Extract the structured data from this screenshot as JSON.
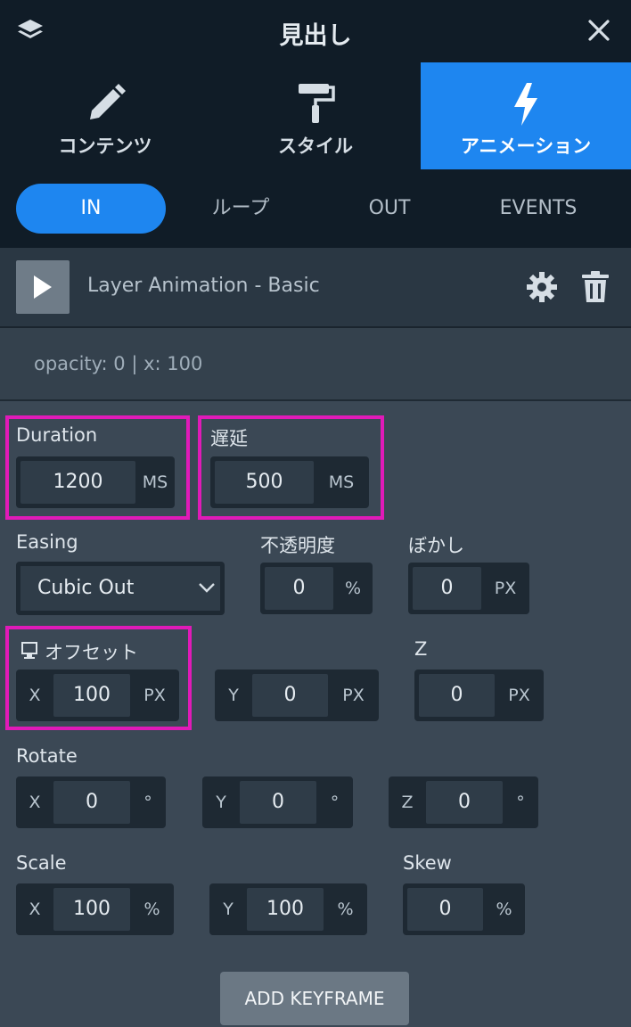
{
  "header": {
    "title": "見出し"
  },
  "main_tabs": [
    {
      "label": "コンテンツ",
      "icon": "pencil-icon"
    },
    {
      "label": "スタイル",
      "icon": "paint-roller-icon"
    },
    {
      "label": "アニメーション",
      "icon": "bolt-icon",
      "active": true
    }
  ],
  "sub_tabs": [
    {
      "label": "IN",
      "active": true
    },
    {
      "label": "ループ"
    },
    {
      "label": "OUT"
    },
    {
      "label": "EVENTS"
    }
  ],
  "animation": {
    "name": "Layer Animation - Basic",
    "summary": "opacity: 0 | x: 100"
  },
  "duration": {
    "label": "Duration",
    "value": "1200",
    "unit": "MS"
  },
  "delay": {
    "label": "遅延",
    "value": "500",
    "unit": "MS"
  },
  "easing": {
    "label": "Easing",
    "value": "Cubic Out"
  },
  "opacity": {
    "label": "不透明度",
    "value": "0",
    "unit": "%"
  },
  "blur": {
    "label": "ぼかし",
    "value": "0",
    "unit": "PX"
  },
  "offset": {
    "label": "オフセット",
    "x": {
      "axis": "X",
      "value": "100",
      "unit": "PX"
    },
    "y": {
      "axis": "Y",
      "value": "0",
      "unit": "PX"
    },
    "z": {
      "label": "Z",
      "value": "0",
      "unit": "PX"
    }
  },
  "rotate": {
    "label": "Rotate",
    "x": {
      "axis": "X",
      "value": "0",
      "unit": "°"
    },
    "y": {
      "axis": "Y",
      "value": "0",
      "unit": "°"
    },
    "z": {
      "axis": "Z",
      "value": "0",
      "unit": "°"
    }
  },
  "scale": {
    "label": "Scale",
    "x": {
      "axis": "X",
      "value": "100",
      "unit": "%"
    },
    "y": {
      "axis": "Y",
      "value": "100",
      "unit": "%"
    }
  },
  "skew": {
    "label": "Skew",
    "value": "0",
    "unit": "%"
  },
  "add_keyframe": "ADD KEYFRAME",
  "colors": {
    "accent": "#1e86f0",
    "highlight": "#e01ab8",
    "panel": "#3b4855",
    "dark": "#101c27"
  }
}
